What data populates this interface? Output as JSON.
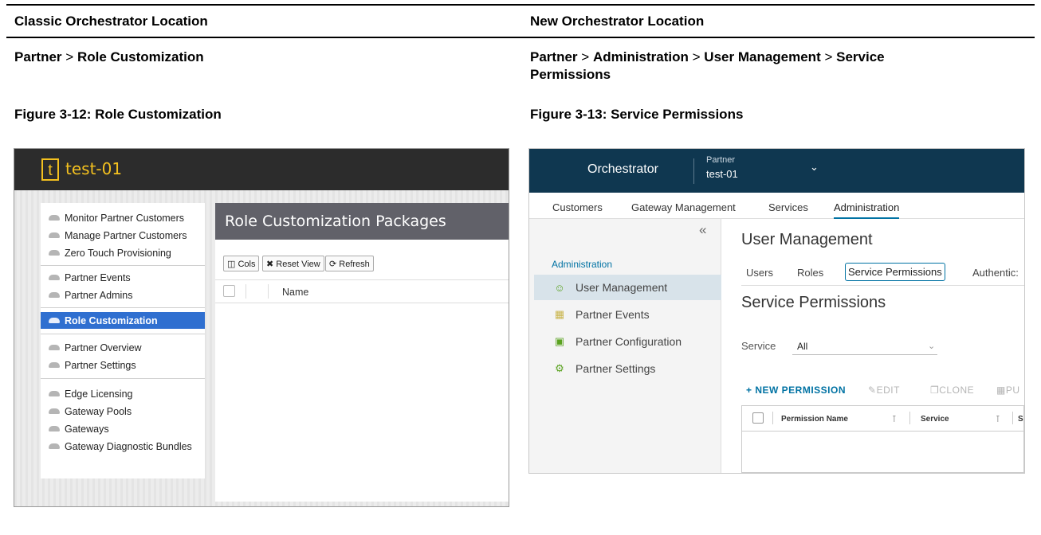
{
  "table": {
    "col1_header": "Classic Orchestrator Location",
    "col2_header": "New Orchestrator Location",
    "col1_path": {
      "p1": "Partner",
      "sep": ">",
      "p2": "Role Customization"
    },
    "col2_path": {
      "p1": "Partner",
      "p2": "Administration",
      "p3": "User Management",
      "p4": "Service Permissions",
      "sep": ">"
    },
    "fig1_caption": "Figure 3-12: Role Customization",
    "fig2_caption": "Figure 3-13: Service Permissions"
  },
  "classic": {
    "logo_letter": "t",
    "app_name": "test-01",
    "accent_color": "#f4c11f",
    "nav": [
      {
        "label": "Monitor Partner Customers"
      },
      {
        "label": "Manage Partner Customers"
      },
      {
        "label": "Zero Touch Provisioning"
      },
      {
        "label": "Partner Events"
      },
      {
        "label": "Partner Admins"
      },
      {
        "label": "Role Customization",
        "active": true
      },
      {
        "label": "Partner Overview"
      },
      {
        "label": "Partner Settings"
      },
      {
        "label": "Edge Licensing"
      },
      {
        "label": "Gateway Pools"
      },
      {
        "label": "Gateways"
      },
      {
        "label": "Gateway Diagnostic Bundles"
      }
    ],
    "page_title": "Role Customization Packages",
    "toolbar": {
      "cols": "◫ Cols",
      "reset": "✖ Reset View",
      "refresh": "⟳ Refresh"
    },
    "grid": {
      "col_name": "Name"
    }
  },
  "new": {
    "app_name": "Orchestrator",
    "context_label": "Partner",
    "context_value": "test-01",
    "top_tabs": [
      "Customers",
      "Gateway Management",
      "Services",
      "Administration"
    ],
    "sidebar": {
      "collapse_icon": "«",
      "section": "Administration",
      "items": [
        {
          "label": "User Management",
          "icon": "users-icon"
        },
        {
          "label": "Partner Events",
          "icon": "calendar-icon"
        },
        {
          "label": "Partner Configuration",
          "icon": "config-icon"
        },
        {
          "label": "Partner Settings",
          "icon": "gear-icon"
        }
      ]
    },
    "page_title": "User Management",
    "sub_tabs": [
      "Users",
      "Roles",
      "Service Permissions",
      "Authentic:"
    ],
    "section_title": "Service Permissions",
    "filter": {
      "label": "Service",
      "value": "All"
    },
    "actions": {
      "new": "+ NEW PERMISSION",
      "edit": "EDIT",
      "clone": "CLONE",
      "more": "PU"
    },
    "grid": {
      "col_name": "Permission Name",
      "col_service": "Service",
      "col_more": "S"
    },
    "brand_color": "#0f3750",
    "link_color": "#0072a3"
  }
}
